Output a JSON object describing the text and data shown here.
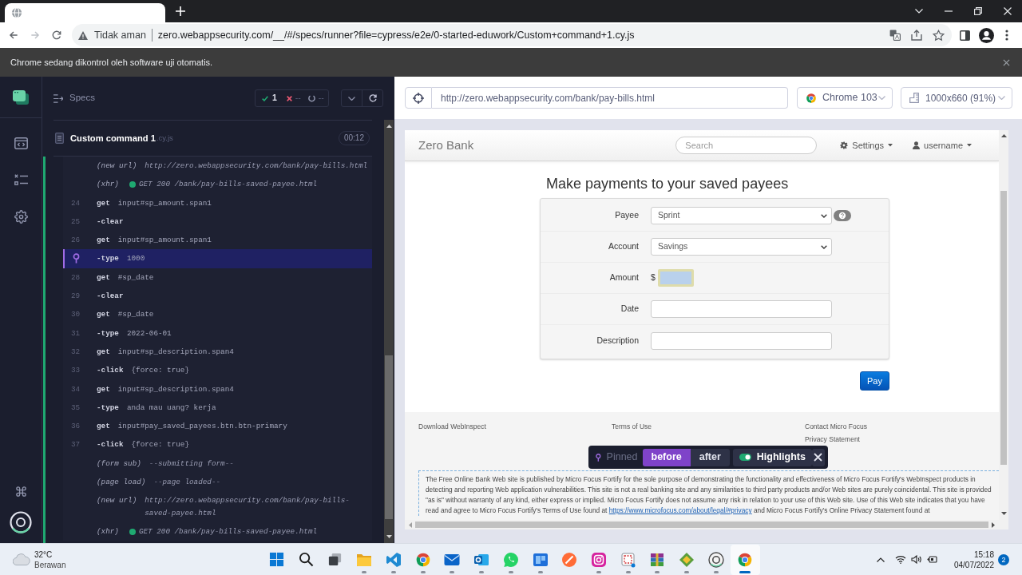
{
  "address_bar": {
    "security_label": "Tidak aman",
    "url": "zero.webappsecurity.com/__/#/specs/runner?file=cypress/e2e/0-started-eduwork/Custom+command+1.cy.js"
  },
  "infobar": {
    "message": "Chrome sedang dikontrol oleh software uji otomatis."
  },
  "reporter": {
    "title": "Specs",
    "stats": {
      "passed": "1",
      "failed": "--",
      "pending": "--"
    },
    "spec": {
      "name": "Custom command 1",
      "extension": ".cy.js",
      "duration": "00:12"
    },
    "commands": [
      {
        "kind": "event",
        "method": "(new url)",
        "message": "http://zero.webappsecurity.com/bank/pay-bills.html",
        "pinned": false
      },
      {
        "kind": "event",
        "method": "(xhr)",
        "message": "GET 200 /bank/pay-bills-saved-payee.html",
        "color": "#1fa971",
        "pinned": false
      },
      {
        "kind": "command",
        "number": "24",
        "method": "get",
        "message": "input#sp_amount.span1",
        "pinned": false
      },
      {
        "kind": "command",
        "number": "25",
        "method": "-clear",
        "pinned": false
      },
      {
        "kind": "command",
        "number": "26",
        "method": "get",
        "message": "input#sp_amount.span1",
        "pinned": false
      },
      {
        "kind": "command",
        "method": "-type",
        "message": "1000",
        "pinned": true
      },
      {
        "kind": "command",
        "number": "28",
        "method": "get",
        "message": "#sp_date",
        "pinned": false
      },
      {
        "kind": "command",
        "number": "29",
        "method": "-clear",
        "pinned": false
      },
      {
        "kind": "command",
        "number": "30",
        "method": "get",
        "message": "#sp_date",
        "pinned": false
      },
      {
        "kind": "command",
        "number": "31",
        "method": "-type",
        "message": "2022-06-01",
        "pinned": false
      },
      {
        "kind": "command",
        "number": "32",
        "method": "get",
        "message": "input#sp_description.span4",
        "pinned": false
      },
      {
        "kind": "command",
        "number": "33",
        "method": "-click",
        "message": "{force: true}",
        "pinned": false
      },
      {
        "kind": "command",
        "number": "34",
        "method": "get",
        "message": "input#sp_description.span4",
        "pinned": false
      },
      {
        "kind": "command",
        "number": "35",
        "method": "-type",
        "message": "anda mau uang? kerja",
        "pinned": false
      },
      {
        "kind": "command",
        "number": "36",
        "method": "get",
        "message": "input#pay_saved_payees.btn.btn-primary",
        "pinned": false
      },
      {
        "kind": "command",
        "number": "37",
        "method": "-click",
        "message": "{force: true}",
        "pinned": false
      },
      {
        "kind": "event",
        "method": "(form sub)",
        "message": "--submitting form--",
        "pinned": false
      },
      {
        "kind": "event",
        "method": "(page load)",
        "message": "--page loaded--",
        "pinned": false
      },
      {
        "kind": "event",
        "method": "(new url)",
        "message": "http://zero.webappsecurity.com/bank/pay-bills-saved-payee.html",
        "pinned": false
      },
      {
        "kind": "event",
        "method": "(xhr)",
        "message": "GET 200 /bank/pay-bills-saved-payee.html",
        "color": "#1fa971",
        "pinned": false
      }
    ]
  },
  "aut": {
    "url": "http://zero.webappsecurity.com/bank/pay-bills.html",
    "browser": "Chrome 103",
    "viewport": "1000x660 (91%)",
    "page": {
      "brand": "Zero Bank",
      "search": {
        "placeholder": "Search"
      },
      "menus": [
        {
          "kind": "settings",
          "label": "Settings"
        },
        {
          "kind": "user",
          "label": "username"
        }
      ],
      "heading": "Make payments to your saved payees",
      "form": [
        {
          "kind": "select",
          "label": "Payee",
          "value": "Sprint",
          "help": true,
          "highlighted": false
        },
        {
          "kind": "select",
          "label": "Account",
          "value": "Savings",
          "help": false,
          "highlighted": false
        },
        {
          "kind": "amount",
          "label": "Amount",
          "prefix": "$",
          "help": false,
          "highlighted": true
        },
        {
          "kind": "text",
          "label": "Date",
          "help": false,
          "highlighted": false
        },
        {
          "kind": "text",
          "label": "Description",
          "help": false,
          "highlighted": false
        }
      ],
      "submit": "Pay",
      "footer_columns": [
        [
          "Download WebInspect"
        ],
        [
          "Terms of Use"
        ],
        [
          "Contact Micro Focus",
          "Privacy Statement"
        ]
      ],
      "disclaimer": {
        "before": "The Free Online Bank Web site is published by Micro Focus Fortify for the sole purpose of demonstrating the functionality and effectiveness of Micro Focus Fortify's WebInspect products in detecting and reporting Web application vulnerabilities. This site is not a real banking site and any similarities to third party products and/or Web sites are purely coincidental. This site is provided \"as is\" without warranty of any kind, either express or implied. Micro Focus Fortify does not assume any risk in relation to your use of this Web site. Use of this Web site indicates that you have read and agree to Micro Focus Fortify's Terms of Use found at ",
        "link": "https://www.microfocus.com/about/legal/#privacy",
        "after": " and Micro Focus Fortify's Online Privacy Statement found at"
      }
    }
  },
  "snapshot_bar": {
    "label": "Pinned",
    "buttons": [
      {
        "label": "before",
        "selected": true
      },
      {
        "label": "after",
        "selected": false
      }
    ],
    "highlights": {
      "label": "Highlights",
      "on": true
    }
  },
  "taskbar": {
    "weather": {
      "temperature": "32°C",
      "condition": "Berawan"
    },
    "apps": [
      {
        "kind": "start",
        "running": false,
        "active": false
      },
      {
        "kind": "search",
        "running": false,
        "active": false
      },
      {
        "kind": "taskview",
        "running": false,
        "active": false
      },
      {
        "kind": "folder",
        "running": true,
        "active": false
      },
      {
        "kind": "code",
        "running": true,
        "active": false
      },
      {
        "kind": "browser",
        "running": true,
        "active": false
      },
      {
        "kind": "mail",
        "running": true,
        "active": false
      },
      {
        "kind": "outlook",
        "running": true,
        "active": false
      },
      {
        "kind": "chat",
        "running": true,
        "active": false
      },
      {
        "kind": "board",
        "running": true,
        "active": false
      },
      {
        "kind": "compass",
        "running": false,
        "active": false
      },
      {
        "kind": "camera",
        "running": true,
        "active": false
      },
      {
        "kind": "snip",
        "running": true,
        "active": false
      },
      {
        "kind": "archive",
        "running": true,
        "active": false
      },
      {
        "kind": "package",
        "running": true,
        "active": false
      },
      {
        "kind": "ring",
        "running": true,
        "active": false
      },
      {
        "kind": "browser",
        "running": true,
        "active": true
      }
    ],
    "clock": {
      "time": "15:18",
      "date": "04/07/2022"
    },
    "notification_count": "2"
  }
}
